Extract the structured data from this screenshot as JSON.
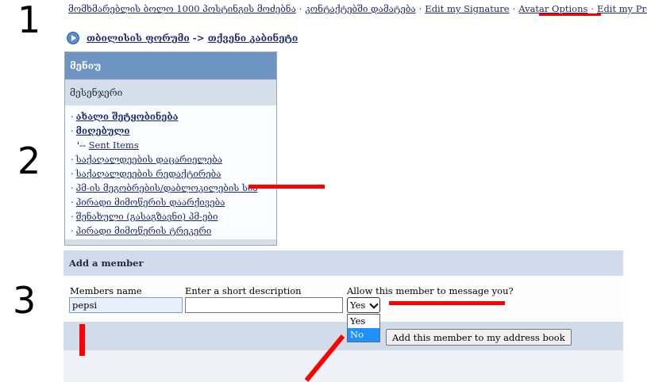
{
  "steps": [
    "1",
    "2",
    "3"
  ],
  "top_links": [
    "მომხმარებლის ბოლო 1000 პოსტინგის მოძებნა",
    "კონტაქტებში დამატება",
    "Edit my Signature",
    "Avatar Options",
    "Edit my Profile"
  ],
  "breadcrumb": {
    "forum": "თბილისის ფორუმი",
    "arrow": "->",
    "cabinet": "თქვენი კაბინეტი"
  },
  "menu": {
    "header": "მენიუ",
    "section": "მესენჯერი",
    "items": [
      "ახალი შეტყობინება",
      "მიღებული",
      "Sent Items",
      "საქაღალდეების დაცარიელება",
      "საქაღალდეების რედაქტირება",
      "პმ-ის მეგობრების/დაბლოკილების სია",
      "პირადი მიმოწერის დაარქივება",
      "შენახული (გასაგზავნი) პმ-ები",
      "პირადი მიმოწერის ტრეკერი"
    ],
    "sub_prefix": "'--"
  },
  "add_member": {
    "title": "Add a member",
    "name_label": "Members name",
    "name_value": "pepsi",
    "desc_label": "Enter a short description",
    "desc_value": "",
    "allow_label": "Allow this member to message you?",
    "selected": "Yes",
    "options": [
      "Yes",
      "No"
    ],
    "highlighted_option": "No",
    "add_button": "Add this member to my address book"
  },
  "colors": {
    "annotation": "#ff0000",
    "link": "#1c2b6e",
    "menu_header": "#6d94c2",
    "highlight": "#1e90ff"
  }
}
